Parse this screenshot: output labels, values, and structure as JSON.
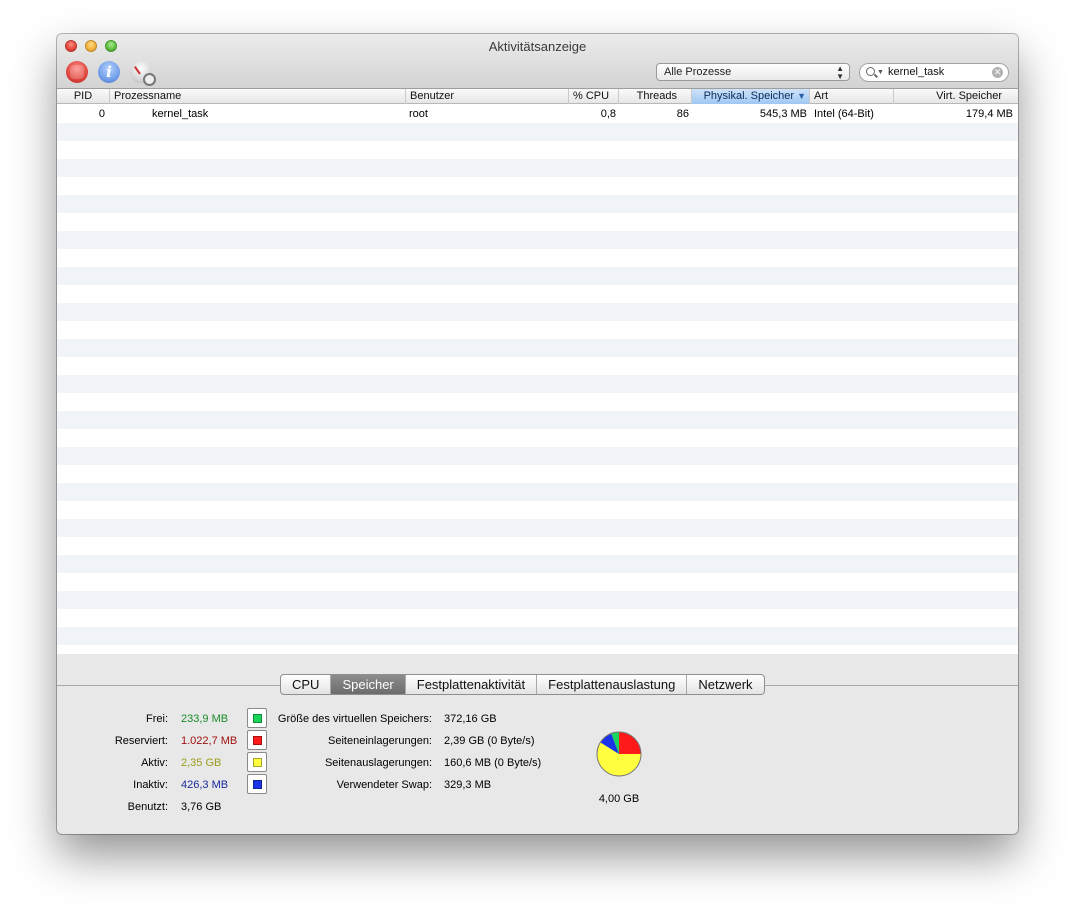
{
  "window": {
    "title": "Aktivitätsanzeige"
  },
  "toolbar": {
    "filter_select": "Alle Prozesse",
    "search_value": "kernel_task"
  },
  "table": {
    "columns": [
      "PID",
      "Prozessname",
      "Benutzer",
      "% CPU",
      "Threads",
      "Physikal. Speicher",
      "Art",
      "Virt. Speicher"
    ],
    "rows": [
      {
        "pid": "0",
        "name": "kernel_task",
        "user": "root",
        "cpu": "0,8",
        "threads": "86",
        "phys_mem": "545,3 MB",
        "arch": "Intel (64-Bit)",
        "virt_mem": "179,4 MB"
      }
    ]
  },
  "tabs": [
    "CPU",
    "Speicher",
    "Festplattenaktivität",
    "Festplattenauslastung",
    "Netzwerk"
  ],
  "memory": {
    "free": {
      "label": "Frei:",
      "value": "233,9 MB"
    },
    "wired": {
      "label": "Reserviert:",
      "value": "1.022,7 MB"
    },
    "active": {
      "label": "Aktiv:",
      "value": "2,35 GB"
    },
    "inactive": {
      "label": "Inaktiv:",
      "value": "426,3 MB"
    },
    "used": {
      "label": "Benutzt:",
      "value": "3,76 GB"
    },
    "vm_size": {
      "label": "Größe des virtuellen Speichers:",
      "value": "372,16 GB"
    },
    "page_ins": {
      "label": "Seiteneinlagerungen:",
      "value": "2,39 GB (0 Byte/s)"
    },
    "page_outs": {
      "label": "Seitenauslagerungen:",
      "value": "160,6 MB (0 Byte/s)"
    },
    "swap": {
      "label": "Verwendeter Swap:",
      "value": "329,3 MB"
    },
    "total": "4,00 GB"
  },
  "colors": {
    "free": "#19d65a",
    "wired": "#ff1a1a",
    "active": "#ffff40",
    "inactive": "#1a33e6",
    "free_text": "#1a8a2a",
    "wired_text": "#a01010",
    "active_text": "#9c9c1a",
    "inactive_text": "#1a2a9a"
  }
}
